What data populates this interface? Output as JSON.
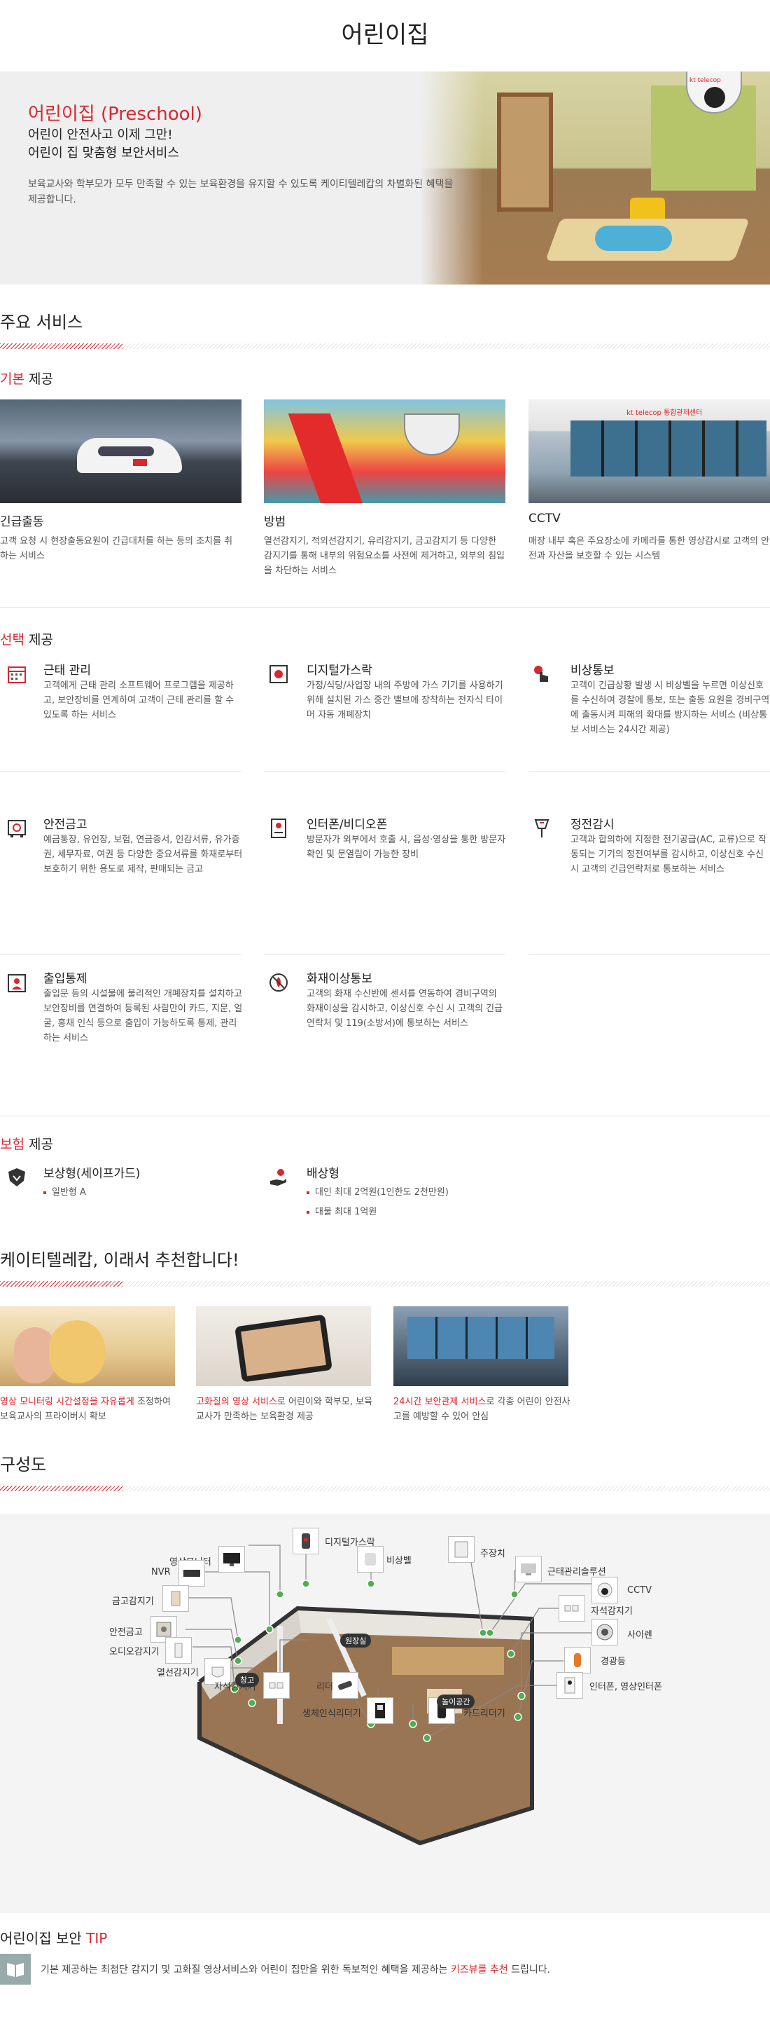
{
  "page_title": "어린이집",
  "hero": {
    "heading": "어린이집 (Preschool)",
    "line1": "어린이 안전사고 이제 그만!",
    "line2": "어린이 집 맞춤형 보안서비스",
    "desc": "보육교사와 학부모가 모두 만족할 수 있는 보육환경을 유지할 수 있도록 케이티텔레캅의 차별화된 혜택을 제공합니다.",
    "cam_brand": "kt telecop"
  },
  "main_services": {
    "title": "주요 서비스",
    "basic": {
      "prefix": "기본",
      "suffix": " 제공",
      "items": [
        {
          "title": "긴급출동",
          "desc": "고객 요청 시 현장출동요원이 긴급대처를 하는 등의 조치를 취하는 서비스"
        },
        {
          "title": "방범",
          "desc": "열선감지기, 적외선감지기, 유리감지기, 금고감지기 등 다양한 감지기를 통해 내부의 위험요소를 사전에 제거하고, 외부의 침입을 차단하는 서비스"
        },
        {
          "title": "CCTV",
          "desc": "매장 내부 혹은 주요장소에 카메라를 통한 영상감시로 고객의 안전과 자산을 보호할 수 있는 시스템",
          "brand": "kt telecop 통합관제센터"
        }
      ]
    },
    "select": {
      "prefix": "선택",
      "suffix": " 제공",
      "items": [
        {
          "title": "근태 관리",
          "desc": "고객에게 근태 관리 소프트웨어 프로그램을 제공하고, 보안장비를 연계하여 고객이 근태 관리를 할 수 있도록 하는 서비스",
          "icon": "calendar-icon"
        },
        {
          "title": "디지털가스락",
          "desc": "가정/식당/사업장 내의 주방에 가스 기기를 사용하기 위해 설치된 가스 중간 밸브에 장착하는 전자식 타이머 자동 개폐장치",
          "icon": "gas-lock-icon"
        },
        {
          "title": "비상통보",
          "desc": "고객이 긴급상황 발생 시 비상벨을 누르면 이상신호를 수신하여 경찰에 통보, 또는 출동 요원을 경비구역에 출동시켜 피해의 확대를 방지하는 서비스 (비상통보 서비스는 24시간 제공)",
          "icon": "emergency-bell-icon"
        },
        {
          "title": "안전금고",
          "desc": "예금통장, 유언장, 보험, 연금증서, 인감서류, 유가증권, 세무자료, 여권 등 다양한 중요서류를 화재로부터 보호하기 위한 용도로 제작, 판매되는 금고",
          "icon": "safe-icon"
        },
        {
          "title": "인터폰/비디오폰",
          "desc": "방문자가 외부에서 호출 시, 음성·영상을 통한 방문자 확인 및 문열림이 가능한 장비",
          "icon": "intercom-icon"
        },
        {
          "title": "정전감시",
          "desc": "고객과 합의하에 지정한 전기공급(AC, 교류)으로 작동되는 기기의 정전여부를 감시하고, 이상신호 수신 시 고객의 긴급연락처로 통보하는 서비스",
          "icon": "power-monitor-icon"
        },
        {
          "title": "출입통제",
          "desc": "출입문 등의 시설물에 물리적인 개폐장치를 설치하고 보안장비를 연결하여 등록된 사람만이 카드, 지문, 얼굴, 홍채 인식 등으로 출입이 가능하도록 통제, 관리하는 서비스",
          "icon": "access-control-icon"
        },
        {
          "title": "화재이상통보",
          "desc": "고객의 화재 수신반에 센서를 연동하여 경비구역의 화재이상을 감시하고, 이상신호 수신 시 고객의 긴급연락처 및 119(소방서)에 통보하는 서비스",
          "icon": "fire-alarm-icon"
        }
      ]
    },
    "insurance": {
      "prefix": "보험",
      "suffix": " 제공",
      "items": [
        {
          "title": "보상형(세이프가드)",
          "bullets": [
            "일반형 A"
          ],
          "icon": "shield-icon"
        },
        {
          "title": "배상형",
          "bullets": [
            "대인 최대 2억원(1인한도 2천만원)",
            "대물 최대 1억원"
          ],
          "icon": "hand-coin-icon"
        }
      ]
    }
  },
  "recommend": {
    "title": "케이티텔레캅, 이래서 추천합니다!",
    "items": [
      {
        "hl": "영상 모니터링 시간설정을 자유롭게",
        "rest": " 조정하여 보육교사의 프라이버시 확보"
      },
      {
        "hl": "고화질의 영상 서비스",
        "rest": "로 어린이와 학부모, 보육교사가 만족하는 보육환경 제공"
      },
      {
        "hl": "24시간 보안관제 서비스",
        "rest": "로 각종 어린이 안전사고를 예방할 수 있어 안심"
      }
    ]
  },
  "diagram": {
    "title": "구성도",
    "labels": {
      "video_monitor": "영상모니터",
      "digital_gas_lock": "디지털가스락",
      "emergency_bell": "비상벨",
      "main_unit": "주장치",
      "attendance_solution": "근태관리솔루션",
      "nvr": "NVR",
      "cctv": "CCTV",
      "safe_sensor": "금고감지기",
      "magnetic_sensor_r": "자석감지기",
      "safe": "안전금고",
      "siren": "사이렌",
      "audio_sensor": "오디오감지기",
      "warning_light": "경광등",
      "heat_sensor": "열선감지기",
      "intercom_video": "인터폰, 영상인터폰",
      "magnetic_sensor_l": "자석감지기",
      "reader": "리더",
      "biometric_reader": "생체인식리더기",
      "card_reader": "카드리더기"
    },
    "tags": {
      "office": "원장실",
      "storage": "창고",
      "play": "놀이공간"
    }
  },
  "tip": {
    "title_prefix": "어린이집 보안 ",
    "title_hl": "TIP",
    "text_pre": "기본 제공하는 최첨단 감지기 및 고화질 영상서비스와 어린이 집만을 위한 독보적인 혜택을 제공하는 ",
    "text_hl": "키즈뷰를 추천",
    "text_post": " 드립니다."
  },
  "colors": {
    "accent": "#d9272e",
    "text": "#222222"
  }
}
